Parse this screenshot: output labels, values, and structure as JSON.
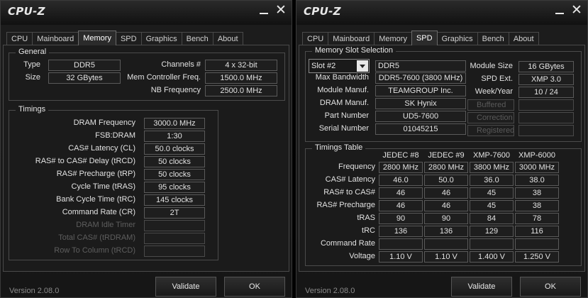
{
  "app_title": "CPU-Z",
  "version": "Version 2.08.0",
  "tabs": [
    "CPU",
    "Mainboard",
    "Memory",
    "SPD",
    "Graphics",
    "Bench",
    "About"
  ],
  "buttons": {
    "validate": "Validate",
    "ok": "OK"
  },
  "memory": {
    "general_title": "General",
    "type_label": "Type",
    "type_value": "DDR5",
    "size_label": "Size",
    "size_value": "32 GBytes",
    "channels_label": "Channels #",
    "channels_value": "4 x 32-bit",
    "mcf_label": "Mem Controller Freq.",
    "mcf_value": "1500.0 MHz",
    "nb_label": "NB Frequency",
    "nb_value": "2500.0 MHz",
    "timings_title": "Timings",
    "rows": [
      {
        "label": "DRAM Frequency",
        "value": "3000.0 MHz"
      },
      {
        "label": "FSB:DRAM",
        "value": "1:30"
      },
      {
        "label": "CAS# Latency (CL)",
        "value": "50.0 clocks"
      },
      {
        "label": "RAS# to CAS# Delay (tRCD)",
        "value": "50 clocks"
      },
      {
        "label": "RAS# Precharge (tRP)",
        "value": "50 clocks"
      },
      {
        "label": "Cycle Time (tRAS)",
        "value": "95 clocks"
      },
      {
        "label": "Bank Cycle Time (tRC)",
        "value": "145 clocks"
      },
      {
        "label": "Command Rate (CR)",
        "value": "2T"
      },
      {
        "label": "DRAM Idle Timer",
        "value": ""
      },
      {
        "label": "Total CAS# (tRDRAM)",
        "value": ""
      },
      {
        "label": "Row To Column (tRCD)",
        "value": ""
      }
    ]
  },
  "spd": {
    "slot_title": "Memory Slot Selection",
    "slot_value": "Slot #2",
    "type_value": "DDR5",
    "max_bw_label": "Max Bandwidth",
    "max_bw_value": "DDR5-7600 (3800 MHz)",
    "manuf_label": "Module Manuf.",
    "manuf_value": "TEAMGROUP Inc.",
    "dram_manuf_label": "DRAM Manuf.",
    "dram_manuf_value": "SK Hynix",
    "part_label": "Part Number",
    "part_value": "UD5-7600",
    "serial_label": "Serial Number",
    "serial_value": "01045215",
    "module_size_label": "Module Size",
    "module_size_value": "16 GBytes",
    "spd_ext_label": "SPD Ext.",
    "spd_ext_value": "XMP 3.0",
    "week_year_label": "Week/Year",
    "week_year_value": "10 / 24",
    "buffered_label": "Buffered",
    "correction_label": "Correction",
    "registered_label": "Registered",
    "timings_title": "Timings Table",
    "columns": [
      "JEDEC #8",
      "JEDEC #9",
      "XMP-7600",
      "XMP-6000"
    ],
    "rows": [
      {
        "label": "Frequency",
        "values": [
          "2800 MHz",
          "2800 MHz",
          "3800 MHz",
          "3000 MHz"
        ]
      },
      {
        "label": "CAS# Latency",
        "values": [
          "46.0",
          "50.0",
          "36.0",
          "38.0"
        ]
      },
      {
        "label": "RAS# to CAS#",
        "values": [
          "46",
          "46",
          "45",
          "38"
        ]
      },
      {
        "label": "RAS# Precharge",
        "values": [
          "46",
          "46",
          "45",
          "38"
        ]
      },
      {
        "label": "tRAS",
        "values": [
          "90",
          "90",
          "84",
          "78"
        ]
      },
      {
        "label": "tRC",
        "values": [
          "136",
          "136",
          "129",
          "116"
        ]
      },
      {
        "label": "Command Rate",
        "values": [
          "",
          "",
          "",
          ""
        ]
      },
      {
        "label": "Voltage",
        "values": [
          "1.10 V",
          "1.10 V",
          "1.400 V",
          "1.250 V"
        ]
      }
    ]
  }
}
